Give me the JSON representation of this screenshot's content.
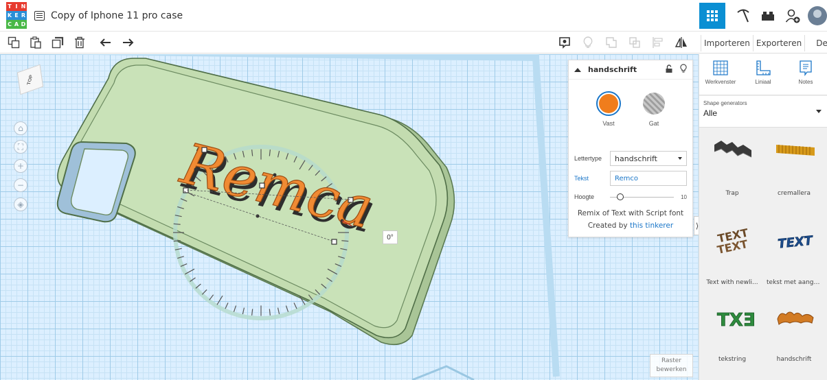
{
  "header": {
    "logo_letters": [
      "T",
      "I",
      "N",
      "K",
      "E",
      "R",
      "C",
      "A",
      "D"
    ],
    "logo_colors": [
      "#e73a2e",
      "#e73a2e",
      "#e73a2e",
      "#2a8fd7",
      "#2a8fd7",
      "#2a8fd7",
      "#49b847",
      "#49b847",
      "#49b847"
    ],
    "title": "Copy of Iphone 11 pro case",
    "icons": [
      "list-icon",
      "grid-view-icon",
      "pickaxe-icon",
      "bricks-icon",
      "add-user-icon",
      "avatar"
    ]
  },
  "toolbar": {
    "left_icons": [
      "copy-icon",
      "paste-icon",
      "duplicate-icon",
      "delete-icon",
      "undo-icon",
      "redo-icon"
    ],
    "mid_icons": [
      "notes-bubble-icon",
      "light-bulb-icon",
      "group-icon",
      "ungroup-icon",
      "align-icon",
      "mirror-icon"
    ],
    "import_label": "Importeren",
    "export_label": "Exporteren",
    "share_label": "Delen"
  },
  "workplane": {
    "viewcube_label": "TOP",
    "object_text": "Remca",
    "rotation_label": "0°",
    "grid_button": {
      "line1": "Raster",
      "line2": "bewerken"
    }
  },
  "inspector": {
    "title": "handschrift",
    "solid_label": "Vast",
    "solid_color": "#f07d1c",
    "hole_label": "Gat",
    "font_label": "Lettertype",
    "font_value": "handschrift",
    "text_label": "Tekst",
    "text_value": "Remco",
    "height_label": "Hoogte",
    "height_max": "10",
    "remix_line": "Remix of Text with Script font",
    "created_prefix": "Created by ",
    "created_link": "this tinkerer"
  },
  "right_panel": {
    "tools": [
      {
        "label": "Werkvenster",
        "icon": "workplane-icon"
      },
      {
        "label": "Liniaal",
        "icon": "ruler-icon"
      },
      {
        "label": "Notes",
        "icon": "notes-icon"
      }
    ],
    "shape_generators_label": "Shape generators",
    "shape_generators_value": "Alle",
    "shapes": [
      {
        "label": "Trap",
        "icon": "stairs-shape-icon"
      },
      {
        "label": "cremallera",
        "icon": "rack-shape-icon"
      },
      {
        "label": "Text with newli...",
        "icon": "text-newline-shape-icon"
      },
      {
        "label": "tekst met aange...",
        "icon": "text-blue-shape-icon"
      },
      {
        "label": "tekstring",
        "icon": "text-ring-shape-icon"
      },
      {
        "label": "handschrift",
        "icon": "handwriting-shape-icon"
      }
    ]
  }
}
